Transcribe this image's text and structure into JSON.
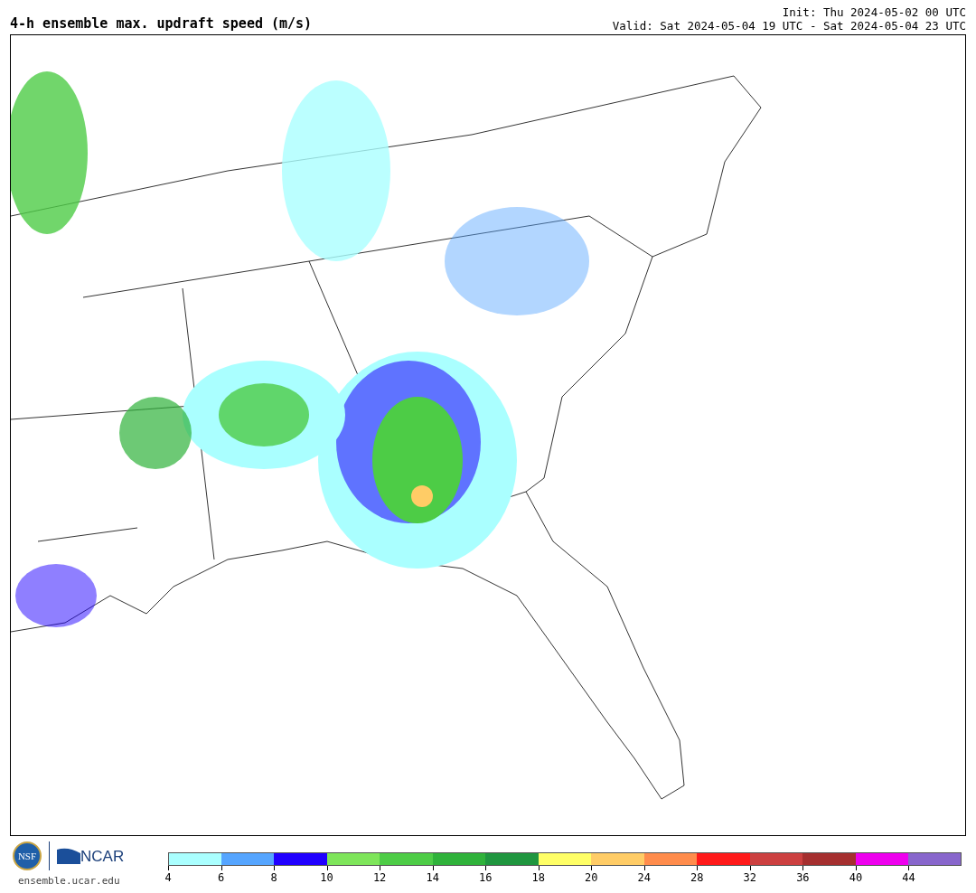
{
  "header": {
    "title": "4-h ensemble max. updraft speed (m/s)",
    "init": "Init: Thu 2024-05-02 00 UTC",
    "valid": "Valid: Sat 2024-05-04 19 UTC - Sat 2024-05-04 23 UTC"
  },
  "footer": {
    "nsf_logo": "NSF",
    "ncar_logo": "NCAR",
    "site": "ensemble.ucar.edu"
  },
  "colorbar": [
    {
      "label": "4",
      "color": "#aaffff"
    },
    {
      "label": "6",
      "color": "#55a5ff"
    },
    {
      "label": "8",
      "color": "#2000ff"
    },
    {
      "label": "10",
      "color": "#7ee55a"
    },
    {
      "label": "12",
      "color": "#4dcc46"
    },
    {
      "label": "14",
      "color": "#2fb23a"
    },
    {
      "label": "16",
      "color": "#1f963f"
    },
    {
      "label": "18",
      "color": "#ffff66"
    },
    {
      "label": "20",
      "color": "#ffcc66"
    },
    {
      "label": "24",
      "color": "#ff8c4c"
    },
    {
      "label": "28",
      "color": "#ff1a1a"
    },
    {
      "label": "32",
      "color": "#cc4040"
    },
    {
      "label": "36",
      "color": "#a52f2f"
    },
    {
      "label": "40",
      "color": "#ee00ee"
    },
    {
      "label": "44",
      "color": "#8866cc"
    }
  ]
}
